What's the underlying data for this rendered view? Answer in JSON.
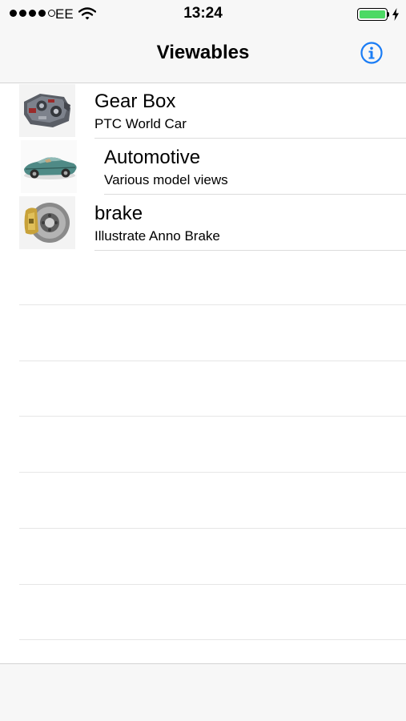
{
  "status_bar": {
    "carrier": "EE",
    "time": "13:24",
    "signal_bars_filled": 4,
    "signal_bars_total": 5,
    "battery_level": 0.9,
    "battery_color": "#4cd964",
    "wifi_icon": "wifi-icon",
    "charging_icon": "bolt-icon"
  },
  "nav": {
    "title": "Viewables",
    "info_icon": "info-icon",
    "accent_color": "#1a7cf5"
  },
  "viewables": [
    {
      "title": "Gear Box",
      "subtitle": "PTC World Car",
      "thumbnail": "gearbox-thumbnail"
    },
    {
      "title": "Automotive",
      "subtitle": "Various model views",
      "thumbnail": "car-thumbnail"
    },
    {
      "title": "brake",
      "subtitle": "Illustrate Anno Brake",
      "thumbnail": "brake-thumbnail"
    }
  ]
}
